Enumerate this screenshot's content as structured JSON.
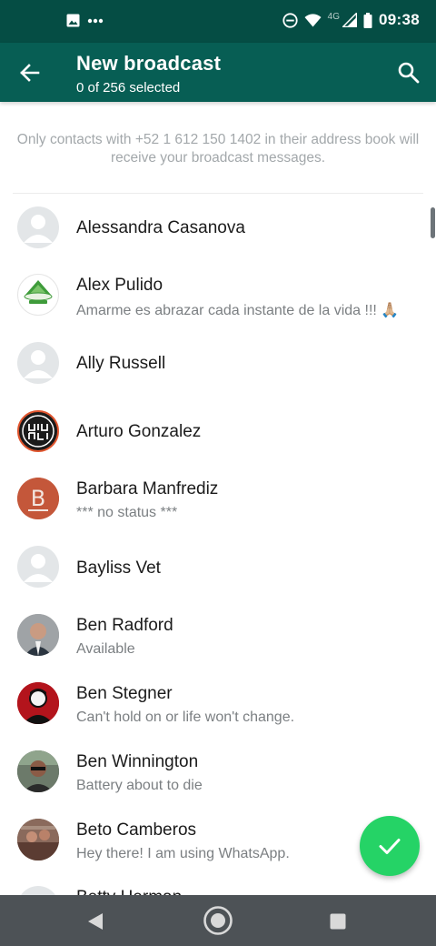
{
  "status_bar": {
    "network": "4G",
    "time": "09:38",
    "icons": [
      "image-icon",
      "more-dots-icon",
      "dnd-icon",
      "wifi-icon",
      "signal-icon",
      "battery-icon"
    ]
  },
  "header": {
    "title": "New broadcast",
    "subtitle": "0 of 256 selected",
    "icons": [
      "back-arrow-icon",
      "search-icon"
    ]
  },
  "info_text": "Only contacts with +52 1 612 150 1402 in their address book will receive your broadcast messages.",
  "contacts": [
    {
      "name": "Alessandra Casanova",
      "status": "",
      "avatar": "placeholder"
    },
    {
      "name": "Alex Pulido",
      "status": "Amarme es abrazar cada instante de la vida !!! 🙏🏼",
      "avatar": "logo"
    },
    {
      "name": "Ally Russell",
      "status": "",
      "avatar": "placeholder"
    },
    {
      "name": "Arturo Gonzalez",
      "status": "",
      "avatar": "logo"
    },
    {
      "name": "Barbara Manfrediz",
      "status": "*** no status ***",
      "avatar": "letter-b"
    },
    {
      "name": "Bayliss Vet",
      "status": "",
      "avatar": "placeholder"
    },
    {
      "name": "Ben Radford",
      "status": "Available",
      "avatar": "photo"
    },
    {
      "name": "Ben Stegner",
      "status": "Can't hold on or life won't change.",
      "avatar": "photo"
    },
    {
      "name": "Ben Winnington",
      "status": "Battery about to die",
      "avatar": "photo"
    },
    {
      "name": "Beto Camberos",
      "status": "Hey there! I am using WhatsApp.",
      "avatar": "photo"
    },
    {
      "name": "Betty Herman",
      "status": "",
      "avatar": "placeholder"
    }
  ],
  "fab": {
    "icon": "checkmark-icon"
  },
  "nav_bar": {
    "icons": [
      "back-triangle-icon",
      "home-circle-icon",
      "recents-square-icon"
    ]
  },
  "colors": {
    "status_bar": "#054d44",
    "app_bar": "#075e54",
    "fab": "#25d366",
    "nav_bar": "#4d5256"
  }
}
